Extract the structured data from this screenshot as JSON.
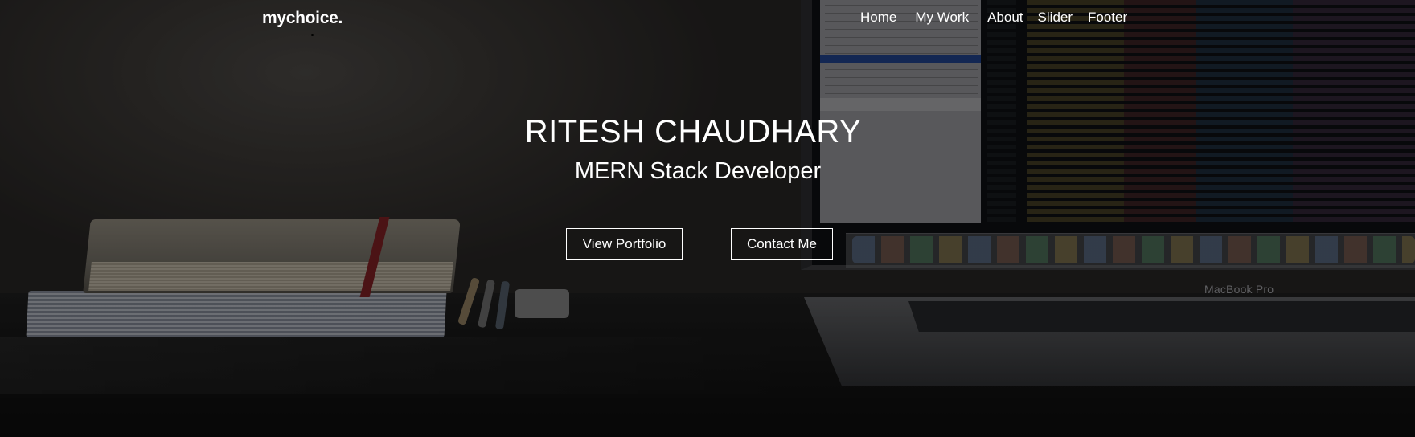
{
  "navbar": {
    "brand": "mychoice.",
    "links": [
      "Home",
      "My Work",
      "About",
      "Slider",
      "Footer"
    ]
  },
  "hero": {
    "title": "RITESH CHAUDHARY",
    "subtitle": "MERN Stack Developer",
    "buttons": {
      "portfolio": "View Portfolio",
      "contact": "Contact Me"
    },
    "background_brand": "MacBook Pro"
  },
  "colors": {
    "text": "#ffffff",
    "overlay": "rgba(0,0,0,0.38)",
    "button_border": "#ffffff"
  }
}
